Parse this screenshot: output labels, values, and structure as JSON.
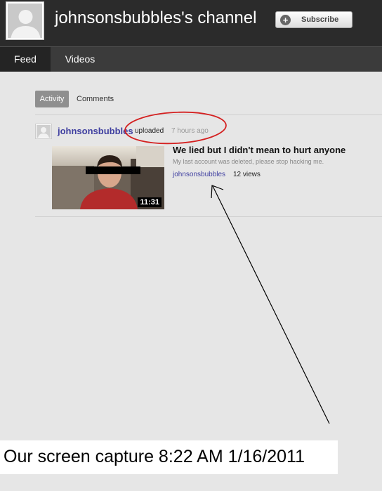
{
  "header": {
    "channel_title": "johnsonsbubbles's channel",
    "subscribe_label": "Subscribe"
  },
  "nav": {
    "tabs": [
      {
        "label": "Feed",
        "active": true
      },
      {
        "label": "Videos",
        "active": false
      }
    ]
  },
  "feed": {
    "filters": [
      {
        "label": "Activity",
        "active": true
      },
      {
        "label": "Comments",
        "active": false
      }
    ],
    "item": {
      "user": "johnsonsbubbles",
      "action": "uploaded",
      "time": "7 hours ago",
      "video": {
        "title": "We lied but I didn't mean to hurt anyone",
        "description": "My last account was deleted, please stop hacking me.",
        "author": "johnsonsbubbles",
        "views": "12 views",
        "duration": "11:31"
      }
    }
  },
  "annotation": {
    "caption": "Our screen capture 8:22 AM 1/16/2011",
    "circle_color": "#d42020",
    "arrow_color": "#000000"
  },
  "colors": {
    "header_bg": "#2b2b2b",
    "nav_bg": "#3b3b3b",
    "link": "#3f3fa0",
    "page_bg": "#e6e6e6"
  }
}
